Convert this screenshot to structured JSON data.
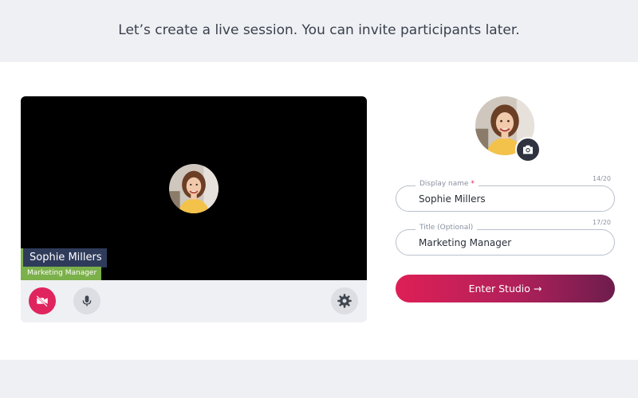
{
  "header": {
    "title": "Let’s create a live session. You can invite participants later."
  },
  "preview": {
    "display_name": "Sophie Millers",
    "title": "Marketing Manager",
    "controls": {
      "camera": "video-off-icon",
      "mic": "microphone-icon",
      "settings": "gear-icon"
    }
  },
  "form": {
    "display_name": {
      "label": "Display name",
      "required_mark": "*",
      "value": "Sophie Millers",
      "counter": "14/20"
    },
    "title": {
      "label": "Title (Optional)",
      "value": "Marketing Manager",
      "counter": "17/20"
    },
    "enter_button": {
      "label": "Enter Studio",
      "arrow": "→"
    }
  },
  "colors": {
    "accent": "#e0245e",
    "tag_blue": "#2f3b5a",
    "tag_green": "#7bb04a",
    "button_gradient_end": "#6d1d4d"
  }
}
